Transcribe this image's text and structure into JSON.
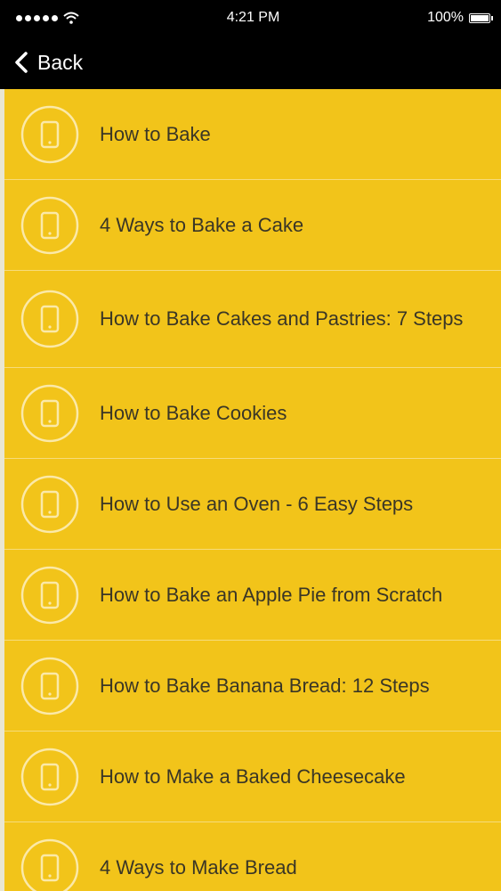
{
  "status_bar": {
    "time": "4:21 PM",
    "battery": "100%"
  },
  "nav": {
    "back_label": "Back"
  },
  "items": [
    {
      "label": "How to Bake"
    },
    {
      "label": "4 Ways to Bake a Cake"
    },
    {
      "label": "How to Bake Cakes and Pastries: 7 Steps"
    },
    {
      "label": "How to Bake Cookies"
    },
    {
      "label": "How to Use an Oven - 6 Easy Steps"
    },
    {
      "label": "How to Bake an Apple Pie from Scratch"
    },
    {
      "label": "How to Bake Banana Bread: 12 Steps"
    },
    {
      "label": "How to Make a Baked Cheesecake"
    },
    {
      "label": "4 Ways to Make Bread"
    }
  ],
  "colors": {
    "list_background": "#f2c41a",
    "bar_background": "#000000",
    "text": "#3a3626",
    "icon_stroke": "#fbe9a8"
  },
  "icons": {
    "item_icon": "phone-icon",
    "back_icon": "chevron-left-icon"
  }
}
